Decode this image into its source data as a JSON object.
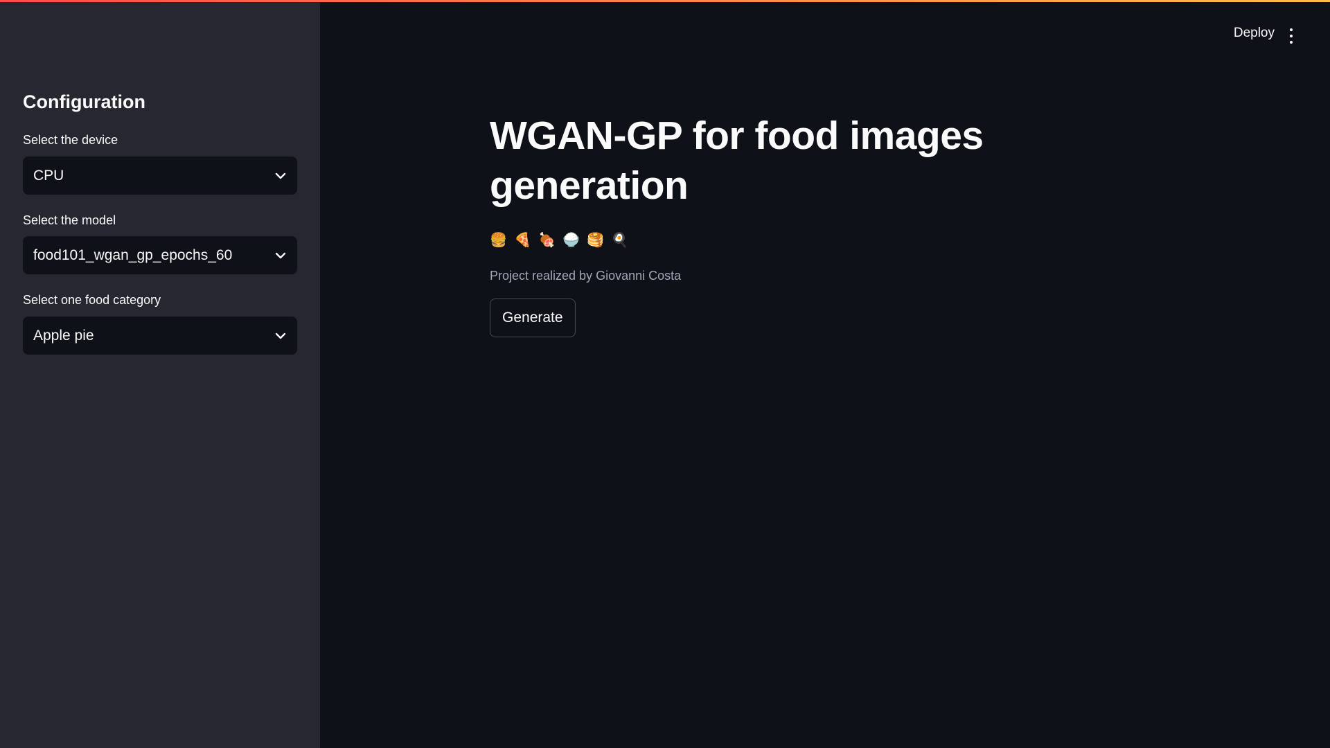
{
  "colors": {
    "background": "#0e1117",
    "sidebar": "#262730",
    "text": "#fafafa",
    "caption": "#a3a8b8",
    "accent_gradient_start": "#ff4b4b",
    "accent_gradient_end": "#ffbd45"
  },
  "header": {
    "deploy_label": "Deploy",
    "menu_icon": "vertical-dots-icon"
  },
  "sidebar": {
    "title": "Configuration",
    "fields": [
      {
        "label": "Select the device",
        "value": "CPU"
      },
      {
        "label": "Select the model",
        "value": "food101_wgan_gp_epochs_60"
      },
      {
        "label": "Select one food category",
        "value": "Apple pie"
      }
    ]
  },
  "main": {
    "title": "WGAN-GP for food images generation",
    "emojis": [
      "🍔",
      "🍕",
      "🍖",
      "🍚",
      "🥞",
      "🍳"
    ],
    "caption": "Project realized by Giovanni Costa",
    "generate_label": "Generate"
  }
}
